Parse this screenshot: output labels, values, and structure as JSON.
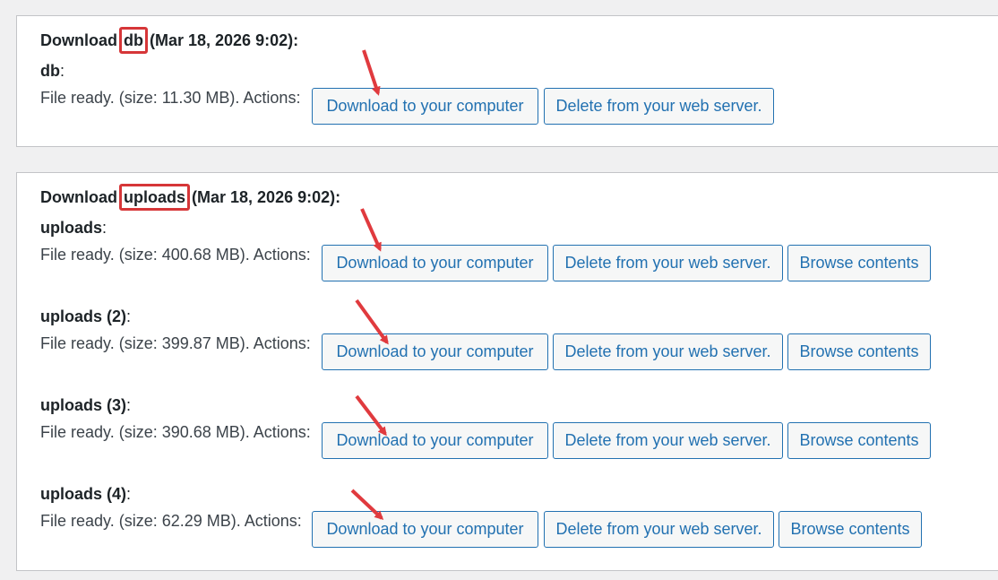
{
  "colors": {
    "accent": "#2271b1",
    "annotation": "#d63638",
    "background": "#f0f0f1"
  },
  "sections": [
    {
      "heading_prefix": "Download",
      "heading_entity": "db",
      "heading_suffix": "(Mar 18, 2026 9:02):",
      "entries": [
        {
          "name": "db",
          "colon": ":",
          "status": "File ready. (size: 11.30 MB). Actions:",
          "buttons": [
            "Download to your computer",
            "Delete from your web server."
          ]
        }
      ]
    },
    {
      "heading_prefix": "Download",
      "heading_entity": "uploads",
      "heading_suffix": "(Mar 18, 2026 9:02):",
      "entries": [
        {
          "name": "uploads",
          "colon": ":",
          "status": "File ready. (size: 400.68 MB). Actions:",
          "buttons": [
            "Download to your computer",
            "Delete from your web server.",
            "Browse contents"
          ]
        },
        {
          "name": "uploads (2)",
          "colon": ":",
          "status": "File ready. (size: 399.87 MB). Actions:",
          "buttons": [
            "Download to your computer",
            "Delete from your web server.",
            "Browse contents"
          ]
        },
        {
          "name": "uploads (3)",
          "colon": ":",
          "status": "File ready. (size: 390.68 MB). Actions:",
          "buttons": [
            "Download to your computer",
            "Delete from your web server.",
            "Browse contents"
          ]
        },
        {
          "name": "uploads (4)",
          "colon": ":",
          "status": "File ready. (size: 62.29 MB). Actions:",
          "buttons": [
            "Download to your computer",
            "Delete from your web server.",
            "Browse contents"
          ]
        }
      ]
    }
  ]
}
